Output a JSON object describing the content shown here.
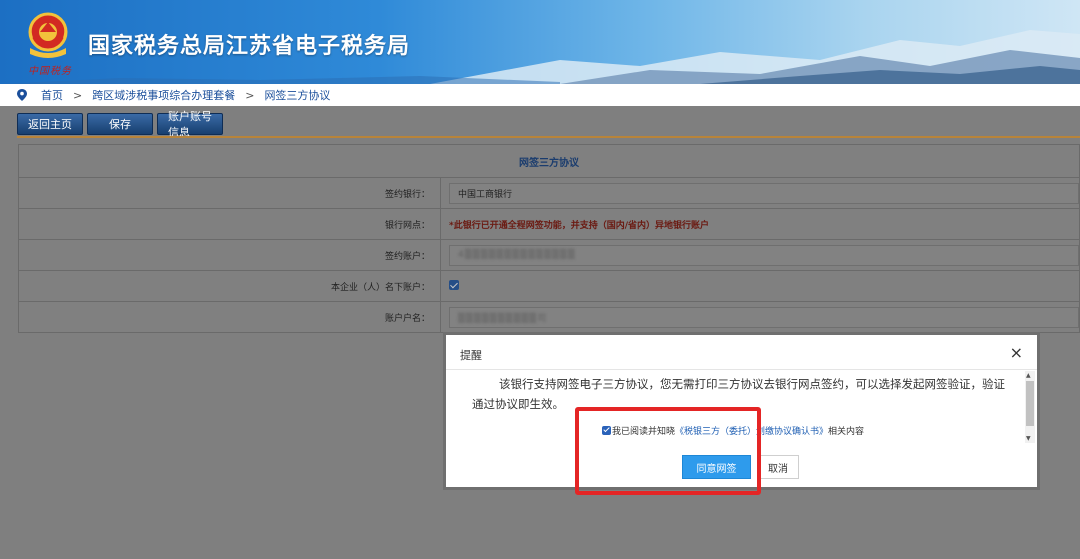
{
  "header": {
    "site_title": "国家税务总局江苏省电子税务局",
    "emblem_caption": "中国税务"
  },
  "breadcrumb": {
    "items": [
      "首页",
      "跨区域涉税事项综合办理套餐",
      "网签三方协议"
    ],
    "separator": ">"
  },
  "toolbar": {
    "back_label": "返回主页",
    "save_label": "保存",
    "account_label": "账户账号信息"
  },
  "form": {
    "section_title": "网签三方协议",
    "rows": [
      {
        "label": "签约银行：",
        "value": "中国工商银行"
      },
      {
        "label": "银行网点：",
        "value": "*此银行已开通全程网签功能，并支持（国内/省内）异地银行账户"
      },
      {
        "label": "签约账户：",
        "value": "4▒▒▒▒▒▒▒▒▒▒▒▒▒▒"
      },
      {
        "label": "本企业（人）名下账户：",
        "value": "checked"
      },
      {
        "label": "账户户名：",
        "value": "▒▒▒▒▒▒▒▒▒▒司"
      }
    ]
  },
  "dialog": {
    "title": "提醒",
    "close_glyph": "×",
    "message": "该银行支持网签电子三方协议，您无需打印三方协议去银行网点签约，可以选择发起网签验证，验证通过协议即生效。",
    "agree_prefix": "我已阅读并知晓",
    "agree_link": "《税银三方（委托）划缴协议确认书》",
    "agree_suffix": "相关内容",
    "confirm_label": "同意网签",
    "cancel_label": "取消"
  },
  "colors": {
    "accent_red": "#e42525",
    "primary_blue": "#2e9bec",
    "link_blue": "#1f5fb3"
  }
}
